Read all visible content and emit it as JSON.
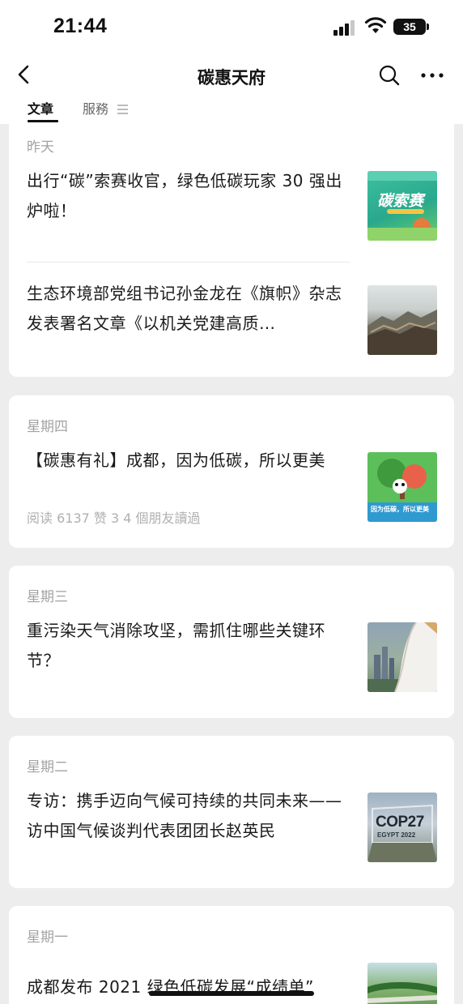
{
  "status_bar": {
    "time": "21:44",
    "battery": "35"
  },
  "nav": {
    "title": "碳惠天府",
    "tabs": [
      {
        "label": "文章"
      },
      {
        "label": "服務"
      }
    ]
  },
  "groups": [
    {
      "day": "昨天",
      "articles": [
        {
          "title": "出行“碳”索赛收官，绿色低碳玩家 30 强出炉啦！",
          "thumb_icon": "carbon-quest-poster-thumbnail",
          "thumb_text": "碳索赛"
        },
        {
          "title": "生态环境部党组书记孙金龙在《旗帜》杂志发表署名文章《以机关党建高质…",
          "thumb_icon": "great-wall-mountains-thumbnail"
        }
      ]
    },
    {
      "day": "星期四",
      "articles": [
        {
          "title": "【碳惠有礼】成都，因为低碳，所以更美",
          "meta": "阅读 6137  赞 3  4 個朋友讀過",
          "thumb_icon": "panda-tree-illustration-thumbnail",
          "thumb_text": "因为低碳，所以更美"
        }
      ]
    },
    {
      "day": "星期三",
      "articles": [
        {
          "title": "重污染天气消除攻坚，需抓住哪些关键环节？",
          "thumb_icon": "city-page-curl-thumbnail"
        }
      ]
    },
    {
      "day": "星期二",
      "articles": [
        {
          "title": "专访：携手迈向气候可持续的共同未来——访中国气候谈判代表团团长赵英民",
          "thumb_icon": "cop27-sign-thumbnail",
          "thumb_text": "COP27",
          "thumb_subtext": "EGYPT 2022"
        }
      ]
    },
    {
      "day": "星期一",
      "articles": [
        {
          "title": "成都发布 2021 绿色低碳发展“成绩单”",
          "thumb_icon": "green-bridge-thumbnail"
        }
      ]
    }
  ],
  "colors": {
    "background": "#ededed",
    "card": "#ffffff",
    "muted_text": "#a3a3a3",
    "title_text": "#1a1a1a"
  }
}
